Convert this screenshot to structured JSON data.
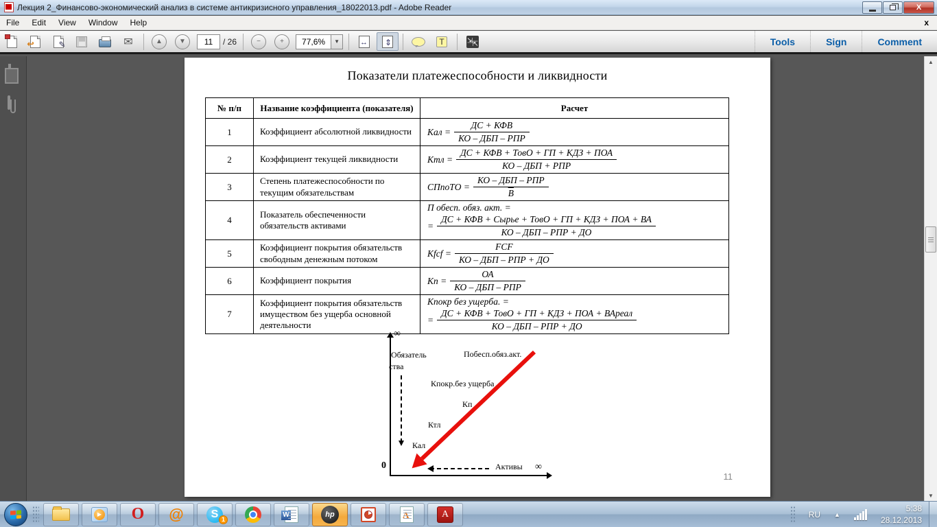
{
  "window": {
    "title": "Лекция 2_Финансово-экономический анализ в системе антикризисного управления_18022013.pdf - Adobe Reader",
    "menus": [
      "File",
      "Edit",
      "View",
      "Window",
      "Help"
    ],
    "menubar_close": "x",
    "close_glyph": "X"
  },
  "toolbar": {
    "page_current": "11",
    "page_total": "/ 26",
    "zoom_value": "77,6%",
    "zoom_drop": "▼",
    "up_glyph": "▲",
    "down_glyph": "▼",
    "minus_glyph": "−",
    "plus_glyph": "+",
    "envelope_glyph": "✉",
    "pen_glyph": "✎",
    "convert_arrow": "↩",
    "text_callout_glyph": "T",
    "play_glyph": "▶",
    "tabs": [
      "Tools",
      "Sign",
      "Comment"
    ]
  },
  "document": {
    "title": "Показатели платежеспособности и ликвидности",
    "page_number": "11",
    "table": {
      "headers": [
        "№ п/п",
        "Название коэффициента (показателя)",
        "Расчет"
      ],
      "rows": [
        {
          "num": "1",
          "name": "Коэффициент абсолютной ликвидности",
          "formula": {
            "lhs": "Кал =",
            "num": "ДС + КФВ",
            "den": "КО – ДБП – РПР"
          }
        },
        {
          "num": "2",
          "name": "Коэффициент текущей ликвидности",
          "formula": {
            "lhs": "Ктл =",
            "num": "ДС + КФВ + ТовО + ГП + КДЗ + ПОА",
            "den": "КО – ДБП + РПР"
          }
        },
        {
          "num": "3",
          "name": "Степень платежеспособности по текущим обязательствам",
          "formula": {
            "lhs": "СПпоТО =",
            "num": "КО – ДБП – РПР",
            "den": "В",
            "den_overline": true
          }
        },
        {
          "num": "4",
          "name": "Показатель обеспеченности обязательств активами",
          "formula": {
            "prefix": "П  обесп.  обяз.  акт. =",
            "lhs": "=",
            "num": "ДС + КФВ + Сырье + ТовО + ГП + КДЗ + ПОА + ВА",
            "den": "КО – ДБП – РПР + ДО"
          }
        },
        {
          "num": "5",
          "name": "Коэффициент покрытия обязательств свободным денежным потоком",
          "formula": {
            "lhs": "Кfcf =",
            "num": "FCF",
            "den": "КО – ДБП – РПР + ДО"
          }
        },
        {
          "num": "6",
          "name": "Коэффициент покрытия",
          "formula": {
            "lhs": "Кп =",
            "num": "ОА",
            "den": "КО – ДБП – РПР"
          }
        },
        {
          "num": "7",
          "name": "Коэффициент покрытия обязательств имуществом без ущерба основной деятельности",
          "formula": {
            "prefix": "Кпокр  без ущерба. =",
            "lhs": "=",
            "num": "ДС + КФВ + ТовО + ГП + КДЗ + ПОА + ВАреал",
            "den": "КО – ДБП – РПР + ДО"
          }
        }
      ]
    },
    "diagram": {
      "inf_top": "∞",
      "inf_right": "∞",
      "y_label_1": "Обязатель",
      "y_label_2": "ства",
      "line_label": "Побесп.обяз.акт.",
      "kpokr": "Кпокр.без ущерба",
      "kp": "Кп",
      "ktl": "Ктл",
      "kal": "Кал",
      "origin": "0",
      "x_label": "Активы"
    }
  },
  "taskbar": {
    "glyphs": {
      "opera": "O",
      "mail": "@",
      "skype": "S",
      "word": "W",
      "hp": "hp",
      "wordpad": "A",
      "adobe": "A",
      "play": "▶"
    },
    "skype_badge": "1",
    "tray": {
      "language": "RU",
      "hidden_arrow": "▲",
      "time": "5:38",
      "date": "28.12.2013"
    }
  }
}
